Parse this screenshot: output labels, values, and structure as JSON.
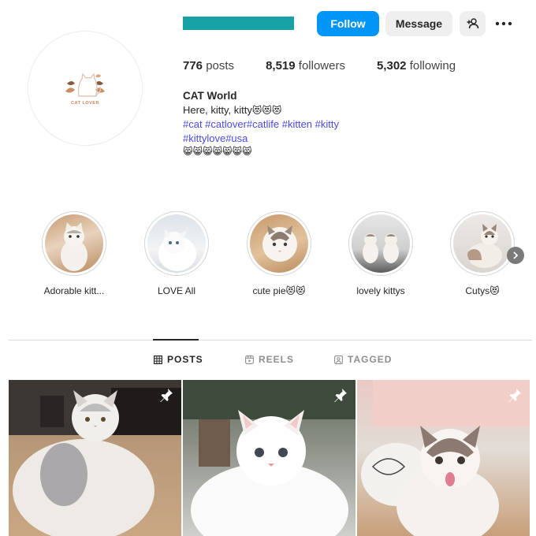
{
  "colors": {
    "accent": "#0095f6",
    "username_bar": "#17a2a5",
    "hashtag": "#4a4adf",
    "muted": "#8e8e8e"
  },
  "header": {
    "avatar_logo_text": "CAT LOVER",
    "follow_label": "Follow",
    "message_label": "Message",
    "add_user_icon": "person-plus-icon",
    "more_icon": "ellipsis-icon"
  },
  "stats": {
    "posts_count": "776",
    "posts_label": "posts",
    "followers_count": "8,519",
    "followers_label": "followers",
    "following_count": "5,302",
    "following_label": "following"
  },
  "bio": {
    "name": "CAT World",
    "line1": "Here, kitty, kitty",
    "line1_emoji": "😻😻😻",
    "tags_line1": "#cat #catlover#catlife #kitten #kitty",
    "tags_line2": "#kittylove#usa",
    "emoji_line": "😸😸😸😸😸😸😸"
  },
  "highlights": [
    {
      "label": "Adorable kitt..."
    },
    {
      "label": "LOVE All"
    },
    {
      "label": "cute pie",
      "emoji": "😻😻"
    },
    {
      "label": "lovely kittys"
    },
    {
      "label": "Cutys",
      "emoji": "😻"
    }
  ],
  "tabs": [
    {
      "label": "POSTS",
      "icon": "grid-icon",
      "active": true
    },
    {
      "label": "REELS",
      "icon": "reels-icon",
      "active": false
    },
    {
      "label": "TAGGED",
      "icon": "tagged-icon",
      "active": false
    }
  ],
  "posts": [
    {
      "pinned": true,
      "icon": "pin-icon"
    },
    {
      "pinned": true,
      "icon": "pin-icon"
    },
    {
      "pinned": true,
      "icon": "pin-icon"
    }
  ]
}
